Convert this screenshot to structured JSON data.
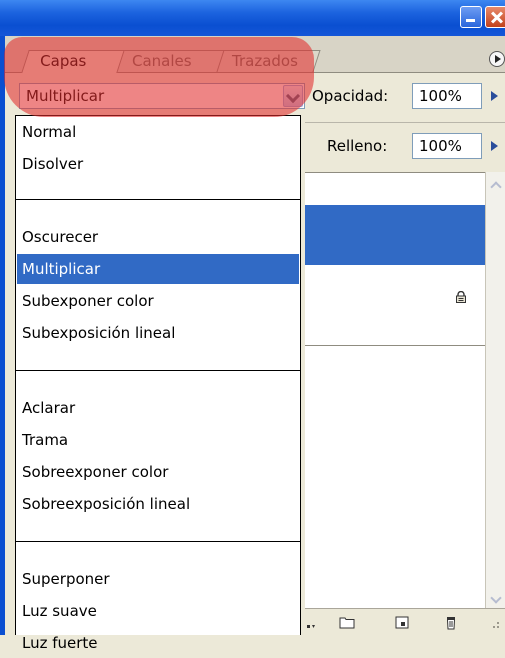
{
  "tabs": [
    {
      "label": "Capas",
      "active": true
    },
    {
      "label": "Canales",
      "active": false
    },
    {
      "label": "Trazados",
      "active": false
    }
  ],
  "blend_mode": {
    "selected": "Multiplicar",
    "groups": [
      [
        "Normal",
        "Disolver"
      ],
      [
        "Oscurecer",
        "Multiplicar",
        "Subexponer color",
        "Subexposición lineal"
      ],
      [
        "Aclarar",
        "Trama",
        "Sobreexponer color",
        "Sobreexposición lineal"
      ],
      [
        "Superponer",
        "Luz suave",
        "Luz fuerte"
      ]
    ]
  },
  "opacity": {
    "label": "Opacidad:",
    "value": "100%"
  },
  "fill": {
    "label": "Relleno:",
    "value": "100%"
  },
  "colors": {
    "selection": "#316ac5",
    "titlebar": "#0a4fd1",
    "highlight": "#e22d2d",
    "panel": "#ece9d8"
  },
  "icons": {
    "lock": "lock-icon",
    "folder": "folder-icon",
    "new_layer": "new-layer-icon",
    "trash": "trash-icon",
    "menu": "panel-menu-icon"
  }
}
